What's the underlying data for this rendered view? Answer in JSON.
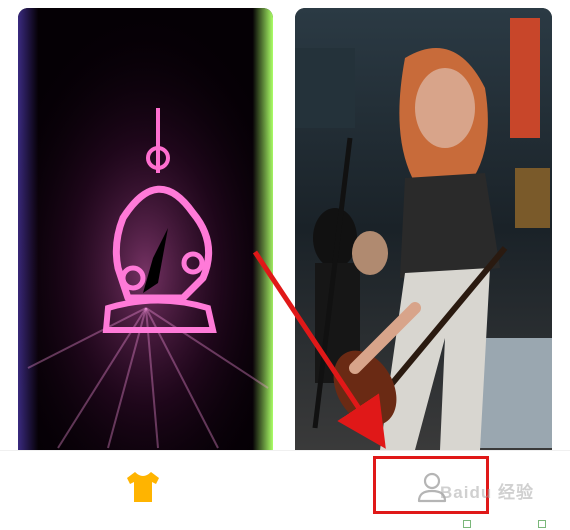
{
  "feed": {
    "cards": [
      {
        "name": "neon-astronaut-wallpaper"
      },
      {
        "name": "guitarist-wallpaper"
      }
    ]
  },
  "tabbar": {
    "tabs": [
      {
        "icon": "tshirt-icon",
        "color": "#ffb400"
      },
      {
        "icon": "user-icon",
        "color": "#b5b5b5"
      }
    ]
  },
  "overlay": {
    "highlight_color": "#e01818",
    "watermark": "Baidu 经验"
  }
}
